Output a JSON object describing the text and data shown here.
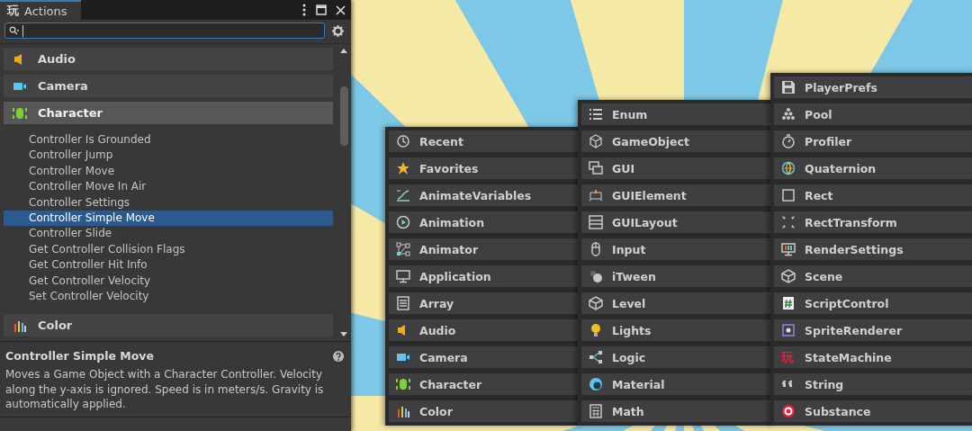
{
  "window": {
    "tab_icon": "玩",
    "title": "Actions"
  },
  "categories": [
    {
      "label": "Audio",
      "expanded": false
    },
    {
      "label": "Camera",
      "expanded": false
    },
    {
      "label": "Character",
      "expanded": true,
      "children": [
        {
          "label": "Controller Is Grounded",
          "selected": false
        },
        {
          "label": "Controller Jump",
          "selected": false
        },
        {
          "label": "Controller Move",
          "selected": false
        },
        {
          "label": "Controller Move In Air",
          "selected": false
        },
        {
          "label": "Controller Settings",
          "selected": false
        },
        {
          "label": "Controller Simple Move",
          "selected": true
        },
        {
          "label": "Controller Slide",
          "selected": false
        },
        {
          "label": "Get Controller Collision Flags",
          "selected": false
        },
        {
          "label": "Get Controller Hit Info",
          "selected": false
        },
        {
          "label": "Get Controller Velocity",
          "selected": false
        },
        {
          "label": "Set Controller Velocity",
          "selected": false
        }
      ]
    },
    {
      "label": "Color",
      "expanded": false
    }
  ],
  "description": {
    "title": "Controller Simple Move",
    "text": "Moves a Game Object with a Character Controller. Velocity along the y-axis is ignored. Speed is in meters/s. Gravity is automatically applied."
  },
  "menus": [
    {
      "items": [
        {
          "label": "Recent"
        },
        {
          "label": "Favorites"
        },
        {
          "label": "AnimateVariables"
        },
        {
          "label": "Animation"
        },
        {
          "label": "Animator"
        },
        {
          "label": "Application"
        },
        {
          "label": "Array"
        },
        {
          "label": "Audio"
        },
        {
          "label": "Camera"
        },
        {
          "label": "Character"
        },
        {
          "label": "Color"
        }
      ]
    },
    {
      "items": [
        {
          "label": "Enum"
        },
        {
          "label": "GameObject"
        },
        {
          "label": "GUI"
        },
        {
          "label": "GUIElement"
        },
        {
          "label": "GUILayout"
        },
        {
          "label": "Input"
        },
        {
          "label": "iTween"
        },
        {
          "label": "Level"
        },
        {
          "label": "Lights"
        },
        {
          "label": "Logic"
        },
        {
          "label": "Material"
        },
        {
          "label": "Math"
        }
      ]
    },
    {
      "items": [
        {
          "label": "PlayerPrefs"
        },
        {
          "label": "Pool"
        },
        {
          "label": "Profiler"
        },
        {
          "label": "Quaternion"
        },
        {
          "label": "Rect"
        },
        {
          "label": "RectTransform"
        },
        {
          "label": "RenderSettings"
        },
        {
          "label": "Scene"
        },
        {
          "label": "ScriptControl"
        },
        {
          "label": "SpriteRenderer"
        },
        {
          "label": "StateMachine",
          "badge": "玩"
        },
        {
          "label": "String"
        },
        {
          "label": "Substance"
        }
      ]
    }
  ]
}
